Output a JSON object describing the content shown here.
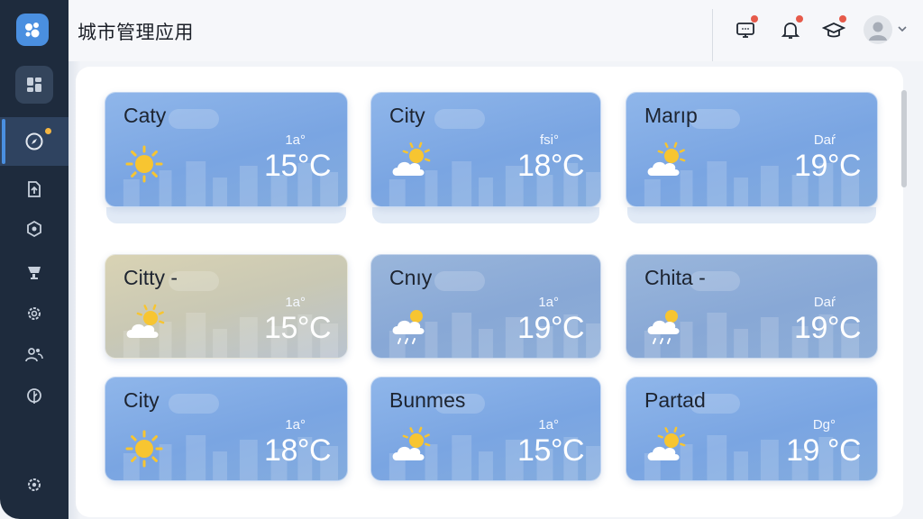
{
  "app": {
    "title": "城市管理应用"
  },
  "sidebar": {
    "items": [
      {
        "name": "dashboard"
      },
      {
        "name": "compass",
        "active": true,
        "has_dot": true
      },
      {
        "name": "upload"
      },
      {
        "name": "settings-hex"
      },
      {
        "name": "cart"
      },
      {
        "name": "gear"
      },
      {
        "name": "users"
      },
      {
        "name": "leaf"
      },
      {
        "name": "settings"
      }
    ]
  },
  "topbar": {
    "icons": [
      "monitor-icon",
      "bell-icon",
      "graduation-cap-icon"
    ],
    "badges": [
      true,
      true,
      true
    ]
  },
  "cards": [
    {
      "city": "Caty",
      "label": "1a°",
      "temp": "15°C",
      "icon": "sun",
      "theme": "blue"
    },
    {
      "city": "City",
      "label": "fsi°",
      "temp": "18°C",
      "icon": "sun-cloud",
      "theme": "blue"
    },
    {
      "city": "Marıp",
      "label": "Daŕ",
      "temp": "19°C",
      "icon": "sun-cloud",
      "theme": "blue"
    },
    {
      "city": "Citty -",
      "label": "1a°",
      "temp": "15°C",
      "icon": "sun-cloud",
      "theme": "warm"
    },
    {
      "city": "Cnıy",
      "label": "1a°",
      "temp": "19°C",
      "icon": "rain",
      "theme": "dim"
    },
    {
      "city": "Chita -",
      "label": "Daŕ",
      "temp": "19°C",
      "icon": "rain",
      "theme": "dim"
    },
    {
      "city": "City",
      "label": "1a°",
      "temp": "18°C",
      "icon": "sun",
      "theme": "blue"
    },
    {
      "city": "Bunmes",
      "label": "1a°",
      "temp": "15°C",
      "icon": "sun-cloud",
      "theme": "blue"
    },
    {
      "city": "Partad",
      "label": "Dg°",
      "temp": "19 °C",
      "icon": "sun-cloud",
      "theme": "blue"
    }
  ],
  "colors": {
    "sidebar": "#1e2b3d",
    "accent": "#4a8fe0",
    "badge": "#e65a4a",
    "active_dot": "#f5b642"
  }
}
